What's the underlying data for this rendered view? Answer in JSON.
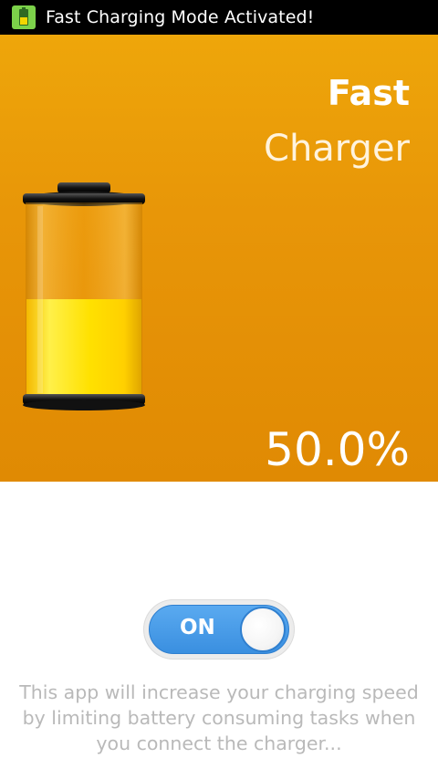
{
  "statusbar": {
    "title": "Fast Charging Mode Activated!",
    "icon": "app-battery-icon"
  },
  "hero": {
    "title_line1": "Fast",
    "title_line2": "Charger",
    "battery_percent_label": "50.0%",
    "battery_level": 0.5,
    "colors": {
      "background": "#e89608",
      "battery_fill": "#ffd800"
    }
  },
  "toggle": {
    "label": "ON",
    "state": "on",
    "accent": "#3a8fe0"
  },
  "description": "This app will increase your charging speed by limiting battery consuming tasks when you connect the charger..."
}
